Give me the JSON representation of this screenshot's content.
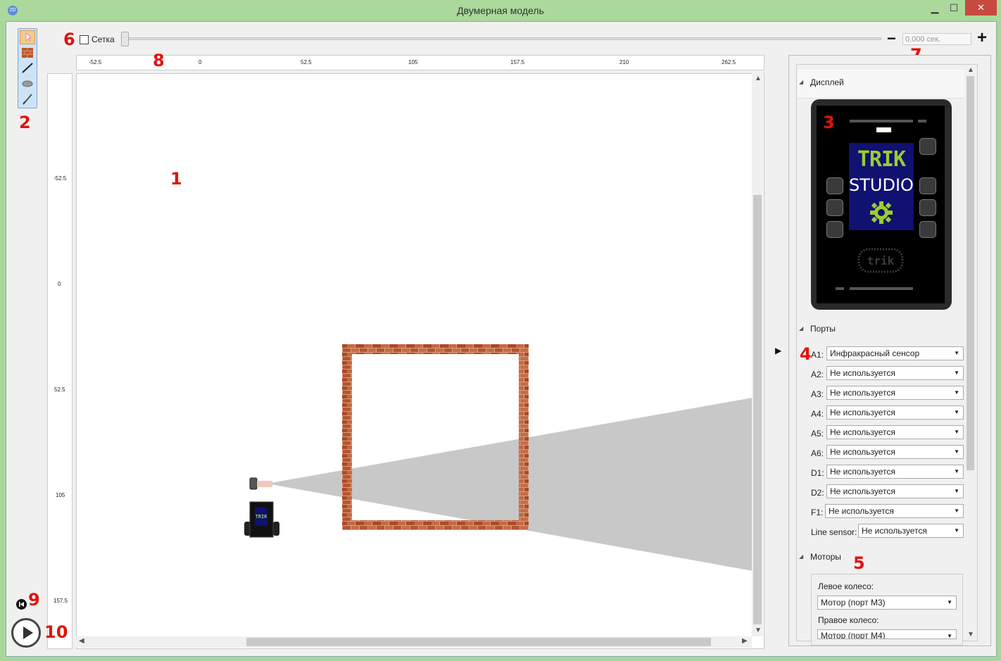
{
  "window": {
    "title": "Двумерная модель",
    "icon_text": "2D",
    "min_glyph": "▁",
    "max_glyph": "☐",
    "close_glyph": "✕"
  },
  "markers": {
    "m1": "1",
    "m2": "2",
    "m3": "3",
    "m4": "4",
    "m5": "5",
    "m6": "6",
    "m7": "7",
    "m8": "8",
    "m9": "9",
    "m10": "10"
  },
  "toolbar": {
    "grid_label": "Сетка",
    "zoom_minus": "−",
    "zoom_plus": "+",
    "time_placeholder": "0,000 сек."
  },
  "ruler_h": {
    "ticks": [
      "-52.5",
      "0",
      "52.5",
      "105",
      "157.5",
      "210",
      "262.5"
    ]
  },
  "ruler_v": {
    "ticks": [
      "-52.5",
      "0",
      "52.5",
      "105",
      "157.5"
    ]
  },
  "panel": {
    "display_title": "Дисплей",
    "ports_title": "Порты",
    "motors_title": "Моторы",
    "device": {
      "trik": "TRIK",
      "studio": "STUDIO",
      "logo": "trik"
    },
    "ports": [
      {
        "label": "A1:",
        "value": "Инфракрасный сенсор"
      },
      {
        "label": "A2:",
        "value": "Не используется"
      },
      {
        "label": "A3:",
        "value": "Не используется"
      },
      {
        "label": "A4:",
        "value": "Не используется"
      },
      {
        "label": "A5:",
        "value": "Не используется"
      },
      {
        "label": "A6:",
        "value": "Не используется"
      },
      {
        "label": "D1:",
        "value": "Не используется"
      },
      {
        "label": "D2:",
        "value": "Не используется"
      },
      {
        "label": "F1:",
        "value": "Не используется"
      },
      {
        "label": "Line sensor:",
        "value": "Не используется"
      }
    ],
    "motors": {
      "left_label": "Левое колесо:",
      "left_value": "Мотор (порт M3)",
      "right_label": "Правое колесо:",
      "right_value": "Мотор (порт M4)"
    }
  },
  "colors": {
    "titlebar": "#aad99b",
    "close": "#c74a3f",
    "brick": "#b3532f",
    "marker": "#e0140f",
    "beam": "#c8c8c8"
  }
}
